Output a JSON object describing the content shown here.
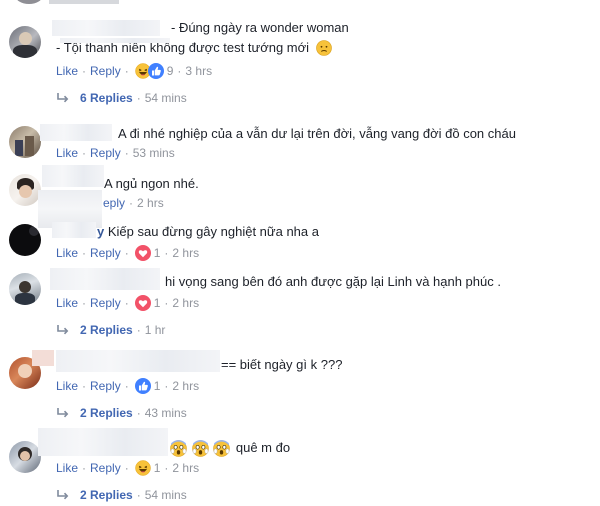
{
  "labels": {
    "like": "Like",
    "reply": "Reply",
    "dot": "·"
  },
  "colors": {
    "link": "#4267b2",
    "meta": "#90949c",
    "text": "#1d2129",
    "love": "#f25268",
    "like_blue": "#4080ff",
    "haha": "#f7c23a"
  },
  "comments": [
    {
      "text_line1": "- Đúng ngày ra wonder woman",
      "text_line2": "- Tội thanh niên không được test tướng mới",
      "line2_emoji": "worried-face-icon",
      "reaction_count": "9",
      "reaction_icons": [
        "haha-icon",
        "like-icon"
      ],
      "reply_label": "Reply",
      "time": "3 hrs",
      "replies": {
        "label": "6 Replies",
        "time": "54 mins"
      }
    },
    {
      "text": "A đi nhé nghiệp của a vẫn dư lại trên đời, vẫng vang đời đồ con cháu",
      "reply_label": "Reply",
      "time": "53 mins"
    },
    {
      "text": "A ngủ ngon nhé.",
      "reply_label": "Reply",
      "reply_label_visible": "eply",
      "time": "2 hrs"
    },
    {
      "name_partial": "y",
      "text": "Kiếp sau đừng gây nghiệt nữa nha a",
      "reaction_count": "1",
      "reaction_icons": [
        "love-icon"
      ],
      "reply_label": "Reply",
      "time": "2 hrs"
    },
    {
      "text": "hi vọng sang bên đó anh được gặp lại Linh và hạnh phúc .",
      "reaction_count": "1",
      "reaction_icons": [
        "love-icon"
      ],
      "reply_label": "Reply",
      "time": "2 hrs",
      "replies": {
        "label": "2 Replies",
        "time": "1 hr"
      }
    },
    {
      "text": "== biết ngày gì k ???",
      "reaction_count": "1",
      "reaction_icons": [
        "like-icon"
      ],
      "reply_label": "Reply",
      "time": "2 hrs",
      "replies": {
        "label": "2 Replies",
        "time": "43 mins"
      }
    },
    {
      "text_emojis": [
        "scream-face-icon",
        "scream-face-icon",
        "scream-face-icon"
      ],
      "text": "quê m đo",
      "reaction_count": "1",
      "reaction_icons": [
        "haha-icon"
      ],
      "reply_label": "Reply",
      "time": "2 hrs",
      "replies": {
        "label": "2 Replies",
        "time": "54 mins"
      }
    }
  ]
}
